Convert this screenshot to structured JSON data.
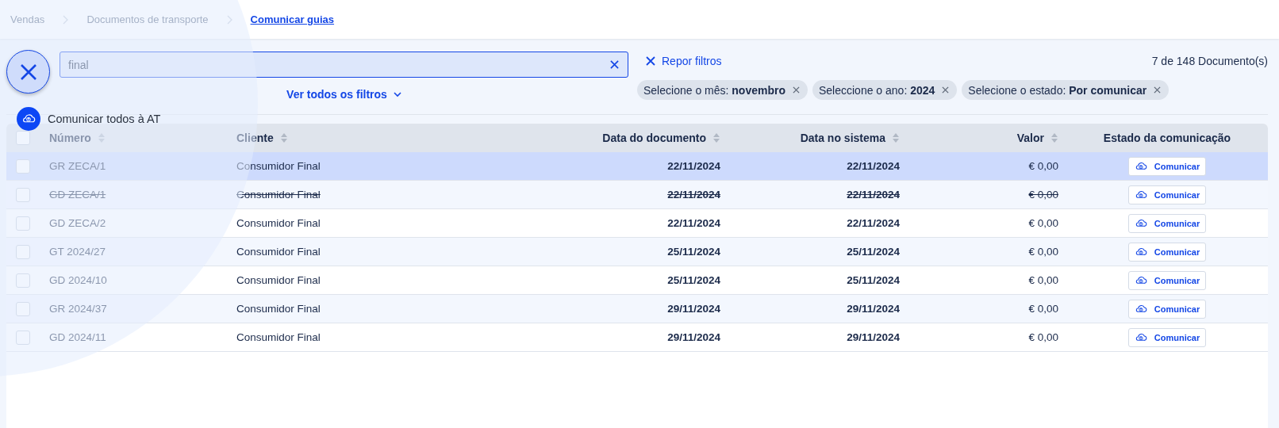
{
  "breadcrumb": [
    {
      "label": "Vendas",
      "current": false
    },
    {
      "label": "Documentos de transporte",
      "current": false
    },
    {
      "label": "Comunicar guias",
      "current": true
    }
  ],
  "search": {
    "value": "final"
  },
  "filters_link": "Ver todos os filtros",
  "reset_filters": "Repor filtros",
  "count": "7 de 148 Documento(s)",
  "chips": [
    {
      "label": "Selecione o mês: **novembro**"
    },
    {
      "label": "Seleccione o ano: **2024**"
    },
    {
      "label": "Selecione o estado: **Por comunicar**"
    }
  ],
  "table": {
    "select_all": {
      "checked": false
    },
    "columns": [
      {
        "label": "Número",
        "sortable": true
      },
      {
        "label": "Cliente",
        "sortable": true
      },
      {
        "label": "Data do documento",
        "sortable": true
      },
      {
        "label": "Data no sistema",
        "sortable": true
      },
      {
        "label": "Valor",
        "sortable": true
      },
      {
        "label": "Estado da comunicação",
        "sortable": false
      }
    ],
    "rows": [
      {
        "number": "GR ZECA/1",
        "client": "Consumidor Final",
        "doc_date": "22/11/2024",
        "sys_date": "22/11/2024",
        "value": "€ 0,00",
        "action": "Comunicar",
        "checked": false,
        "selected": true,
        "voided": false
      },
      {
        "number": "GD ZECA/1",
        "client": "Consumidor Final",
        "doc_date": "22/11/2024",
        "sys_date": "22/11/2024",
        "value": "€ 0,00",
        "action": "Comunicar",
        "checked": false,
        "selected": false,
        "voided": true
      },
      {
        "number": "GD ZECA/2",
        "client": "Consumidor Final",
        "doc_date": "22/11/2024",
        "sys_date": "22/11/2024",
        "value": "€ 0,00",
        "action": "Comunicar",
        "checked": false,
        "selected": false,
        "voided": false
      },
      {
        "number": "GT 2024/27",
        "client": "Consumidor Final",
        "doc_date": "25/11/2024",
        "sys_date": "25/11/2024",
        "value": "€ 0,00",
        "action": "Comunicar",
        "checked": false,
        "selected": false,
        "voided": false
      },
      {
        "number": "GD 2024/10",
        "client": "Consumidor Final",
        "doc_date": "25/11/2024",
        "sys_date": "25/11/2024",
        "value": "€ 0,00",
        "action": "Comunicar",
        "checked": false,
        "selected": false,
        "voided": false
      },
      {
        "number": "GR 2024/37",
        "client": "Consumidor Final",
        "doc_date": "29/11/2024",
        "sys_date": "29/11/2024",
        "value": "€ 0,00",
        "action": "Comunicar",
        "checked": false,
        "selected": false,
        "voided": false
      },
      {
        "number": "GD 2024/11",
        "client": "Consumidor Final",
        "doc_date": "29/11/2024",
        "sys_date": "29/11/2024",
        "value": "€ 0,00",
        "action": "Comunicar",
        "checked": false,
        "selected": false,
        "voided": false
      }
    ]
  },
  "speed_dial": {
    "open": true,
    "actions": [
      {
        "label": "Comunicar todos à AT"
      }
    ]
  }
}
